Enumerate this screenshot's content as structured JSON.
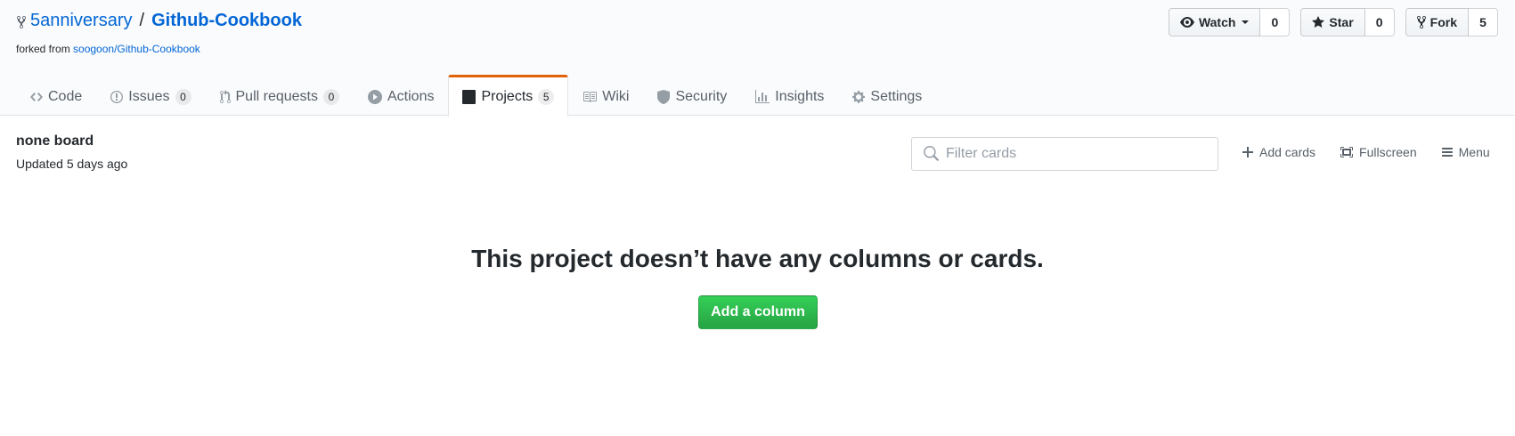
{
  "repo": {
    "owner": "5anniversary",
    "separator": "/",
    "name": "Github-Cookbook",
    "forked_from_label": "forked from",
    "forked_from_link": "soogoon/Github-Cookbook"
  },
  "actions": {
    "watch": {
      "label": "Watch",
      "count": "0"
    },
    "star": {
      "label": "Star",
      "count": "0"
    },
    "fork": {
      "label": "Fork",
      "count": "5"
    }
  },
  "nav": {
    "code": {
      "label": "Code"
    },
    "issues": {
      "label": "Issues",
      "count": "0"
    },
    "pulls": {
      "label": "Pull requests",
      "count": "0"
    },
    "actions": {
      "label": "Actions"
    },
    "projects": {
      "label": "Projects",
      "count": "5"
    },
    "wiki": {
      "label": "Wiki"
    },
    "security": {
      "label": "Security"
    },
    "insights": {
      "label": "Insights"
    },
    "settings": {
      "label": "Settings"
    }
  },
  "project": {
    "name": "none board",
    "updated": "Updated 5 days ago"
  },
  "toolbar": {
    "filter_placeholder": "Filter cards",
    "add_cards": "Add cards",
    "fullscreen": "Fullscreen",
    "menu": "Menu"
  },
  "empty": {
    "message": "This project doesn’t have any columns or cards.",
    "button": "Add a column"
  },
  "colors": {
    "link": "#0366d6",
    "selected_tab_accent": "#e36209",
    "primary_button": "#28a745"
  }
}
